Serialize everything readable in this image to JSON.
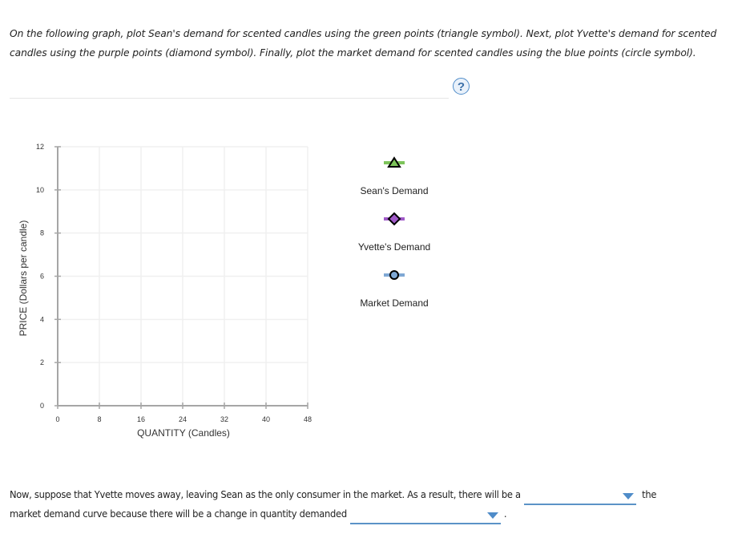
{
  "instructions": "On the following graph, plot Sean's demand for scented candles using the green points (triangle symbol). Next, plot Yvette's demand for scented candles using the purple points (diamond symbol). Finally, plot the market demand for scented candles using the blue points (circle symbol).",
  "help_icon": "question-mark-icon",
  "help_label": "?",
  "chart_data": {
    "type": "scatter",
    "title": "",
    "xlabel": "QUANTITY (Candles)",
    "ylabel": "PRICE (Dollars per candle)",
    "xlim": [
      0,
      48
    ],
    "ylim": [
      0,
      12
    ],
    "xticks": [
      0,
      8,
      16,
      24,
      32,
      40,
      48
    ],
    "yticks": [
      0,
      2,
      4,
      6,
      8,
      10,
      12
    ],
    "grid": true,
    "legend_placement": "right",
    "series": [
      {
        "name": "Sean's Demand",
        "symbol": "triangle",
        "color": "#7dc45a",
        "points": []
      },
      {
        "name": "Yvette's Demand",
        "symbol": "diamond",
        "color": "#a05ac8",
        "points": []
      },
      {
        "name": "Market Demand",
        "symbol": "circle",
        "color": "#7fa8d4",
        "points": []
      }
    ]
  },
  "question": {
    "part1": "Now, suppose that Yvette moves away, leaving Sean as the only consumer in the market. As a result, there will be a",
    "part2": "the",
    "part3": "market demand curve because there will be a change in quantity demanded",
    "part4": ".",
    "dropdown1_value": "",
    "dropdown2_value": ""
  },
  "colors": {
    "accent": "#4f8cc9",
    "axis": "#a6a6a6",
    "grid": "#f0f0f0"
  }
}
